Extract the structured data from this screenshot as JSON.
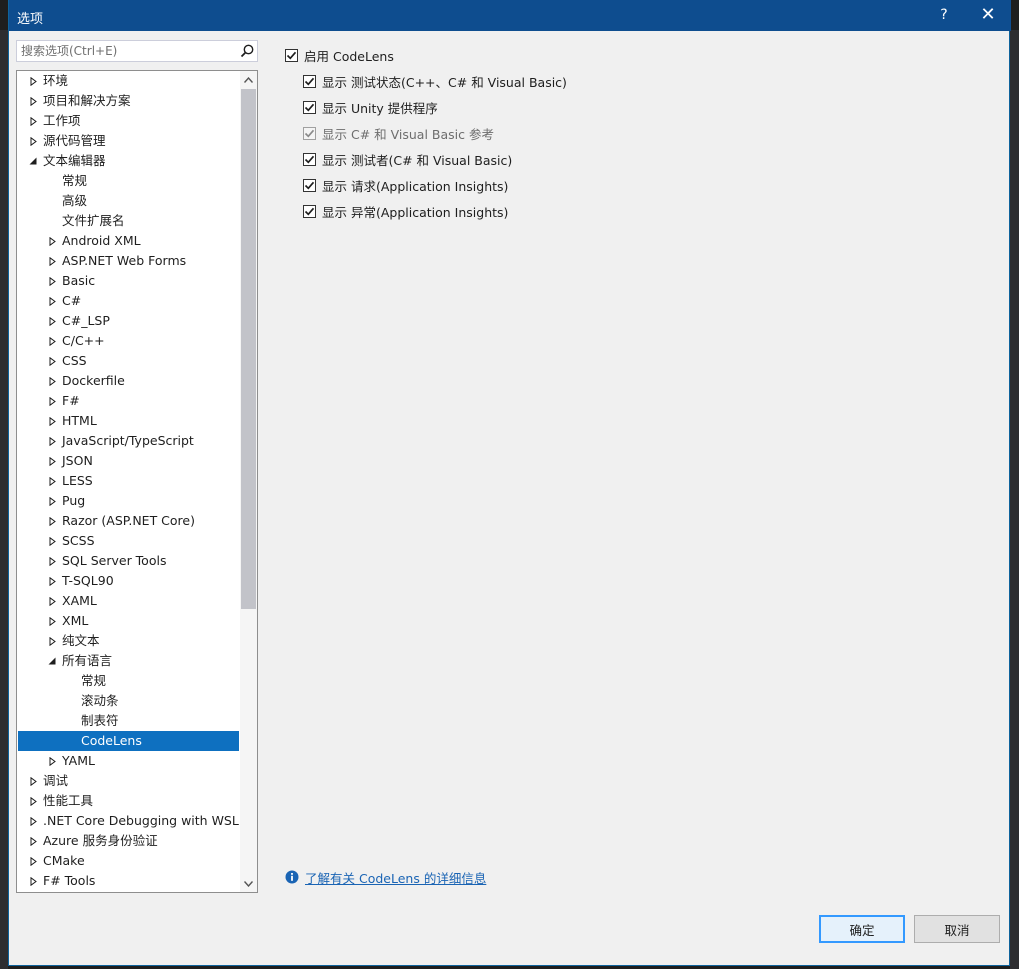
{
  "window": {
    "title": "选项",
    "help_glyph": "?",
    "close_glyph": "✕"
  },
  "search": {
    "placeholder": "搜索选项(Ctrl+E)",
    "value": ""
  },
  "tree": {
    "items": [
      {
        "label": "环境",
        "level": 0,
        "state": "collapsed"
      },
      {
        "label": "项目和解决方案",
        "level": 0,
        "state": "collapsed"
      },
      {
        "label": "工作项",
        "level": 0,
        "state": "collapsed"
      },
      {
        "label": "源代码管理",
        "level": 0,
        "state": "collapsed"
      },
      {
        "label": "文本编辑器",
        "level": 0,
        "state": "expanded"
      },
      {
        "label": "常规",
        "level": 1,
        "state": "leaf"
      },
      {
        "label": "高级",
        "level": 1,
        "state": "leaf"
      },
      {
        "label": "文件扩展名",
        "level": 1,
        "state": "leaf"
      },
      {
        "label": "Android XML",
        "level": 1,
        "state": "collapsed"
      },
      {
        "label": "ASP.NET Web Forms",
        "level": 1,
        "state": "collapsed"
      },
      {
        "label": "Basic",
        "level": 1,
        "state": "collapsed"
      },
      {
        "label": "C#",
        "level": 1,
        "state": "collapsed"
      },
      {
        "label": "C#_LSP",
        "level": 1,
        "state": "collapsed"
      },
      {
        "label": "C/C++",
        "level": 1,
        "state": "collapsed"
      },
      {
        "label": "CSS",
        "level": 1,
        "state": "collapsed"
      },
      {
        "label": "Dockerfile",
        "level": 1,
        "state": "collapsed"
      },
      {
        "label": "F#",
        "level": 1,
        "state": "collapsed"
      },
      {
        "label": "HTML",
        "level": 1,
        "state": "collapsed"
      },
      {
        "label": "JavaScript/TypeScript",
        "level": 1,
        "state": "collapsed"
      },
      {
        "label": "JSON",
        "level": 1,
        "state": "collapsed"
      },
      {
        "label": "LESS",
        "level": 1,
        "state": "collapsed"
      },
      {
        "label": "Pug",
        "level": 1,
        "state": "collapsed"
      },
      {
        "label": "Razor (ASP.NET Core)",
        "level": 1,
        "state": "collapsed"
      },
      {
        "label": "SCSS",
        "level": 1,
        "state": "collapsed"
      },
      {
        "label": "SQL Server Tools",
        "level": 1,
        "state": "collapsed"
      },
      {
        "label": "T-SQL90",
        "level": 1,
        "state": "collapsed"
      },
      {
        "label": "XAML",
        "level": 1,
        "state": "collapsed"
      },
      {
        "label": "XML",
        "level": 1,
        "state": "collapsed"
      },
      {
        "label": "纯文本",
        "level": 1,
        "state": "collapsed"
      },
      {
        "label": "所有语言",
        "level": 1,
        "state": "expanded"
      },
      {
        "label": "常规",
        "level": 2,
        "state": "leaf"
      },
      {
        "label": "滚动条",
        "level": 2,
        "state": "leaf"
      },
      {
        "label": "制表符",
        "level": 2,
        "state": "leaf"
      },
      {
        "label": "CodeLens",
        "level": 2,
        "state": "leaf",
        "selected": true
      },
      {
        "label": "YAML",
        "level": 1,
        "state": "collapsed"
      },
      {
        "label": "调试",
        "level": 0,
        "state": "collapsed"
      },
      {
        "label": "性能工具",
        "level": 0,
        "state": "collapsed"
      },
      {
        "label": ".NET Core Debugging with WSL",
        "level": 0,
        "state": "collapsed"
      },
      {
        "label": "Azure 服务身份验证",
        "level": 0,
        "state": "collapsed"
      },
      {
        "label": "CMake",
        "level": 0,
        "state": "collapsed"
      },
      {
        "label": "F# Tools",
        "level": 0,
        "state": "collapsed"
      }
    ]
  },
  "options": {
    "enable_codelens": {
      "label": "启用 CodeLens",
      "checked": true
    },
    "sub_options": [
      {
        "label": "显示 测试状态(C++、C# 和 Visual Basic)",
        "checked": true,
        "disabled": false
      },
      {
        "label": "显示 Unity 提供程序",
        "checked": true,
        "disabled": false
      },
      {
        "label": "显示 C# 和 Visual Basic 参考",
        "checked": true,
        "disabled": true
      },
      {
        "label": "显示 测试者(C# 和 Visual Basic)",
        "checked": true,
        "disabled": false
      },
      {
        "label": "显示 请求(Application Insights)",
        "checked": true,
        "disabled": false
      },
      {
        "label": "显示 异常(Application Insights)",
        "checked": true,
        "disabled": false
      }
    ]
  },
  "info_link": {
    "label": "了解有关 CodeLens 的详细信息",
    "icon": "info-icon"
  },
  "buttons": {
    "ok": "确定",
    "cancel": "取消"
  },
  "colors": {
    "title_bar": "#0e4d8f",
    "selection": "#0e70c0",
    "link": "#1a64b4",
    "default_button_border": "#3399ff"
  }
}
